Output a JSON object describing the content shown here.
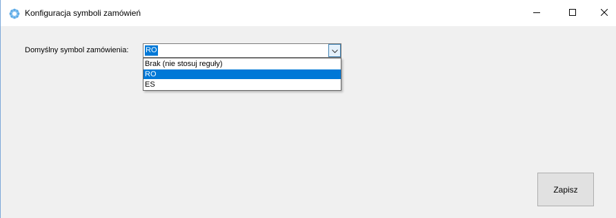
{
  "window": {
    "title": "Konfiguracja symboli zamówień",
    "icon": "gear-app-icon"
  },
  "caption_buttons": {
    "minimize": "minimize-icon",
    "maximize": "maximize-icon",
    "close": "close-icon"
  },
  "form": {
    "symbol_label": "Domyślny symbol zamówienia:",
    "symbol_selected": "RO",
    "symbol_options": [
      "Brak (nie stosuj reguły)",
      "RO",
      "ES"
    ],
    "symbol_highlighted_index": 1
  },
  "actions": {
    "save_label": "Zapisz"
  },
  "colors": {
    "accent": "#0078d7",
    "icon_blue": "#5aa9e6"
  }
}
